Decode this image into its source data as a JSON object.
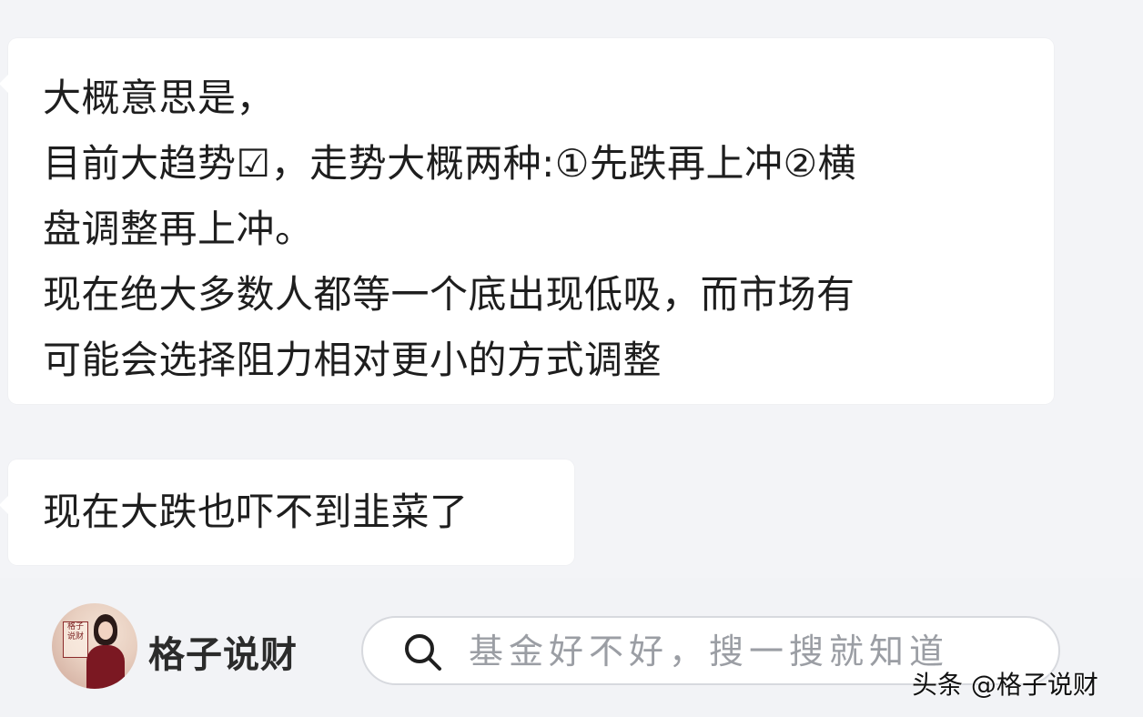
{
  "messages": [
    {
      "lines": [
        "大概意思是，",
        "目前大趋势☑，走势大概两种:①先跌再上冲②横",
        "盘调整再上冲。",
        "现在绝大多数人都等一个底出现低吸，而市场有",
        "可能会选择阻力相对更小的方式调整"
      ]
    },
    {
      "lines": [
        "现在大跌也吓不到韭菜了"
      ]
    }
  ],
  "footer": {
    "avatar_seal": "格子说财",
    "brand_name": "格子说财",
    "search_icon": "search-icon",
    "search_placeholder": "基金好不好，搜一搜就知道"
  },
  "watermark": "头条 @格子说财"
}
